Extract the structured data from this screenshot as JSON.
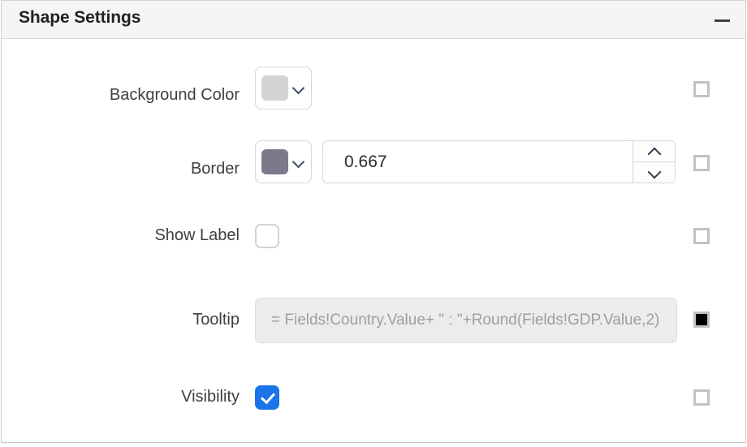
{
  "panel": {
    "title": "Shape Settings",
    "collapse_icon": "minus-icon"
  },
  "rows": [
    {
      "label": "Background Color",
      "control": "color-picker",
      "swatch_color": "#d4d4d4",
      "dropdown_icon": "chevron-down-icon",
      "expression_checkbox": false
    },
    {
      "label": "Border",
      "control": "color-picker-with-number",
      "swatch_color": "#7a7a8c",
      "dropdown_icon": "chevron-down-icon",
      "value": "0.667",
      "stepper_up_icon": "chevron-up-icon",
      "stepper_down_icon": "chevron-down-icon",
      "expression_checkbox": false
    },
    {
      "label": "Show Label",
      "control": "checkbox",
      "checked": false,
      "expression_checkbox": false
    },
    {
      "label": "Tooltip",
      "control": "expression",
      "value": "= Fields!Country.Value+ \" : \"+Round(Fields!GDP.Value,2)",
      "expression_checkbox": true
    },
    {
      "label": "Visibility",
      "control": "checkbox",
      "checked": true,
      "expression_checkbox": false
    }
  ],
  "colors": {
    "accent": "#1a73e8",
    "header_bg": "#f5f5f5",
    "border": "#c8c8c8",
    "disabled_bg": "#ececec",
    "placeholder_text": "#9aa0a6"
  }
}
